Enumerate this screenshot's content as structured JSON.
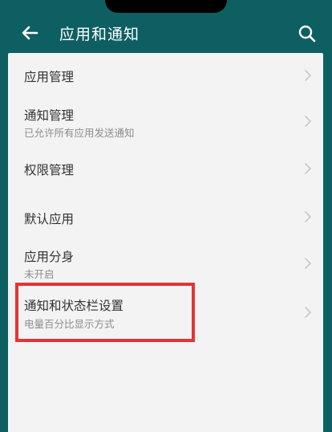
{
  "header": {
    "title": "应用和通知"
  },
  "items": [
    {
      "title": "应用管理",
      "subtitle": ""
    },
    {
      "title": "通知管理",
      "subtitle": "已允许所有应用发送通知"
    },
    {
      "title": "权限管理",
      "subtitle": ""
    },
    {
      "title": "默认应用",
      "subtitle": ""
    },
    {
      "title": "应用分身",
      "subtitle": "未开启"
    },
    {
      "title": "通知和状态栏设置",
      "subtitle": "电量百分比显示方式"
    }
  ],
  "colors": {
    "header_background": "#0e5f62",
    "content_background": "#f3f3f3",
    "highlight_border": "#e33335"
  },
  "icons": {
    "back": "back-arrow-icon",
    "search": "search-icon",
    "chevron": "chevron-right-icon"
  }
}
